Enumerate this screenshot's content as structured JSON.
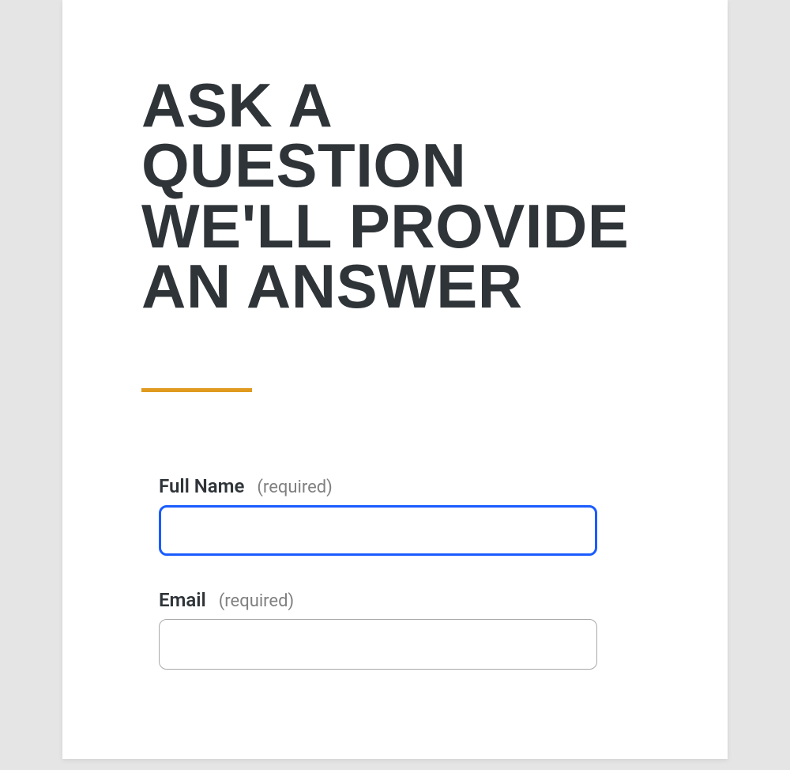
{
  "heading": "ASK A QUESTION WE'LL PROVIDE AN ANSWER",
  "form": {
    "fields": [
      {
        "label": "Full Name",
        "required_text": "(required)",
        "value": "",
        "focused": true
      },
      {
        "label": "Email",
        "required_text": "(required)",
        "value": "",
        "focused": false
      }
    ]
  },
  "colors": {
    "accent": "#e09a1f",
    "text_dark": "#2f3438",
    "focus_blue": "#1a5cff",
    "muted": "#808080"
  }
}
